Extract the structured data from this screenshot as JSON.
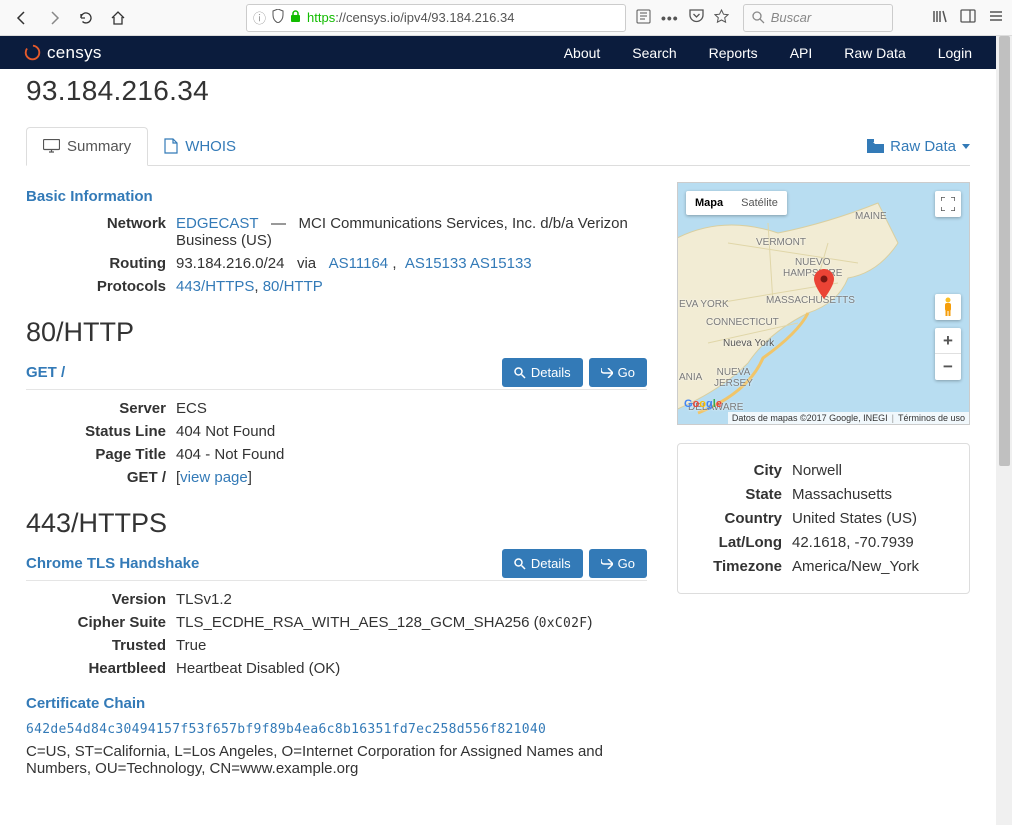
{
  "browser": {
    "url_proto": "https",
    "url_host": "://censys.io",
    "url_path": "/ipv4/93.184.216.34",
    "search_placeholder": "Buscar"
  },
  "nav": {
    "brand": "censys",
    "items": [
      "About",
      "Search",
      "Reports",
      "API",
      "Raw Data",
      "Login"
    ]
  },
  "ip": "93.184.216.34",
  "tabs": {
    "summary": "Summary",
    "whois": "WHOIS",
    "rawdata": "Raw Data"
  },
  "basic": {
    "title": "Basic Information",
    "network_label": "Network",
    "network_link": "EDGECAST",
    "network_sep": "—",
    "network_rest": "MCI Communications Services, Inc. d/b/a Verizon Business (US)",
    "routing_label": "Routing",
    "routing_cidr": "93.184.216.0/24",
    "routing_via": "via",
    "routing_as1": "AS11164",
    "routing_comma": ",",
    "routing_as2": "AS15133 AS15133",
    "protocols_label": "Protocols",
    "proto1": "443/HTTPS",
    "proto_comma": ",",
    "proto2": "80/HTTP"
  },
  "http": {
    "heading": "80/HTTP",
    "subhead": "GET /",
    "details_btn": "Details",
    "go_btn": "Go",
    "server_label": "Server",
    "server": "ECS",
    "status_label": "Status Line",
    "status": "404 Not Found",
    "title_label": "Page Title",
    "title": "404 - Not Found",
    "get_label": "GET /",
    "get_open": "[",
    "get_link": "view page",
    "get_close": "]"
  },
  "https": {
    "heading": "443/HTTPS",
    "subhead": "Chrome TLS Handshake",
    "details_btn": "Details",
    "go_btn": "Go",
    "version_label": "Version",
    "version": "TLSv1.2",
    "cipher_label": "Cipher Suite",
    "cipher_name": "TLS_ECDHE_RSA_WITH_AES_128_GCM_SHA256 (",
    "cipher_code": "0xC02F",
    "cipher_close": ")",
    "trusted_label": "Trusted",
    "trusted": "True",
    "hb_label": "Heartbleed",
    "hb": "Heartbeat Disabled (OK)"
  },
  "cert": {
    "title": "Certificate Chain",
    "hash": "642de54d84c30494157f53f657bf9f89b4ea6c8b16351fd7ec258d556f821040",
    "dn": "C=US, ST=California, L=Los Angeles, O=Internet Corporation for Assigned Names and Numbers, OU=Technology, CN=www.example.org"
  },
  "map": {
    "tab_map": "Mapa",
    "tab_sat": "Satélite",
    "attr_data": "Datos de mapas ©2017 Google, INEGI",
    "attr_terms": "Términos de uso",
    "labels": {
      "maine": "MAINE",
      "vermont": "VERMONT",
      "nh": "NUEVO\nHAMPSHIRE",
      "mass": "MASSACHUSETTS",
      "ny": "EVA YORK",
      "ct": "CONNECTICUT",
      "nyc": "Nueva York",
      "nj": "NUEVA\nJERSEY",
      "pa": "ANIA",
      "de": "DELAWARE"
    }
  },
  "loc": {
    "city_l": "City",
    "city": "Norwell",
    "state_l": "State",
    "state": "Massachusetts",
    "country_l": "Country",
    "country": "United States (US)",
    "latlong_l": "Lat/Long",
    "latlong": "42.1618, -70.7939",
    "tz_l": "Timezone",
    "tz": "America/New_York"
  }
}
